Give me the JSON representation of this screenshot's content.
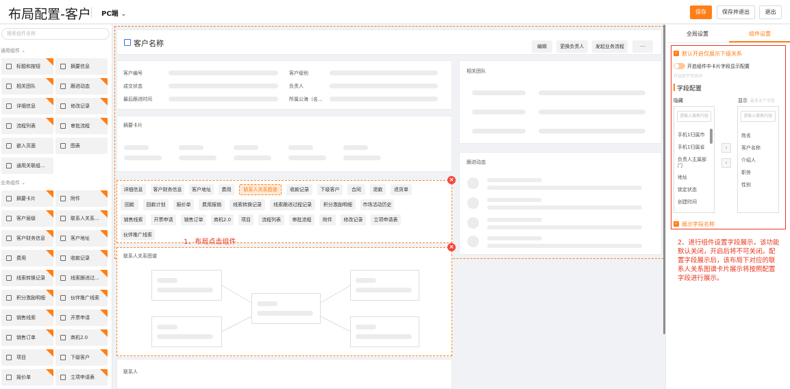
{
  "header": {
    "title": "布局配置-客户",
    "device": "PC端",
    "save": "保存",
    "save_exit": "保存并退出",
    "exit": "退出"
  },
  "left": {
    "search_placeholder": "搜索组件名称",
    "group_common": "通用组件",
    "group_business": "业务组件",
    "common": [
      "标题和按钮",
      "摘要信息",
      "相关团队",
      "跟进动态",
      "详细信息",
      "修改记录",
      "流程列表",
      "审批流程",
      "嵌入页面",
      "图表",
      "通用关联组..."
    ],
    "business": [
      "摘要卡片",
      "附件",
      "客户层级",
      "联系人关系...",
      "客户财务信息",
      "客户地址",
      "费用",
      "收款记录",
      "线索转换记录",
      "线索跟进过...",
      "积分激励明细",
      "伙伴推广线索",
      "销售线索",
      "开票申请",
      "销售订单",
      "商机2.0",
      "项目",
      "下级客户",
      "报价单",
      "立项申请表"
    ]
  },
  "card_header": {
    "name": "客户名称",
    "buttons": [
      "编辑",
      "更换负责人",
      "发起业务流程",
      "···"
    ]
  },
  "detail": {
    "fields": [
      "客户编号",
      "客户级别",
      "成交状态",
      "负责人",
      "最后跟进时间",
      "所属公海（名..."
    ]
  },
  "summary_card": {
    "title": "摘要卡片"
  },
  "related_team": {
    "title": "相关团队"
  },
  "followup": {
    "title": "跟进动态"
  },
  "tabs": [
    "详细信息",
    "客户财务信息",
    "客户地址",
    "费用",
    "联系人关系图谱",
    "收款记录",
    "下级客户",
    "合同",
    "退款",
    "退货单",
    "回款",
    "回款计划",
    "报价单",
    "费用报销",
    "线索转换记录",
    "线索跟进过程记录",
    "积分激励明细",
    "市场活动历史",
    "销售线索",
    "开票申请",
    "销售订单",
    "商机2.0",
    "项目",
    "流程列表",
    "审批流程",
    "附件",
    "修改记录",
    "立项申请表",
    "伙伴推广线索"
  ],
  "annotation1": "1、布局点击组件",
  "relation_map": {
    "title": "联系人关系图谱"
  },
  "contacts": {
    "title": "联系人"
  },
  "right": {
    "tab_global": "全局设置",
    "tab_component": "组件设置",
    "default_sub": "默认开启仅展示下级关系",
    "card_field_toggle": "开启组件中卡片字段显示配置",
    "toggle_hint": "开启后不可关闭",
    "field_config": "字段配置",
    "hidden_label": "隐藏",
    "shown_label": "显示",
    "shown_hint": "最多五个字段",
    "search_placeholder": "请输入搜索内容",
    "hidden_fields": [
      "手机1归属市",
      "手机1归属省",
      "负责人主属部门",
      "地址",
      "锁定状态",
      "创建时间"
    ],
    "shown_fields": [
      "姓名",
      "客户名称",
      "介绍人",
      "职务",
      "性别"
    ],
    "show_field_name": "展示字段名称"
  },
  "annotation2": "2、进行组件设置字段展示，该功能默认关闭，开启后将不可关闭。配置字段展示后，该布局下对应的联系人关系图谱卡片展示将按照配置字段进行展示。",
  "colors": {
    "accent": "#ff7f16",
    "annotation": "#e9361e"
  }
}
